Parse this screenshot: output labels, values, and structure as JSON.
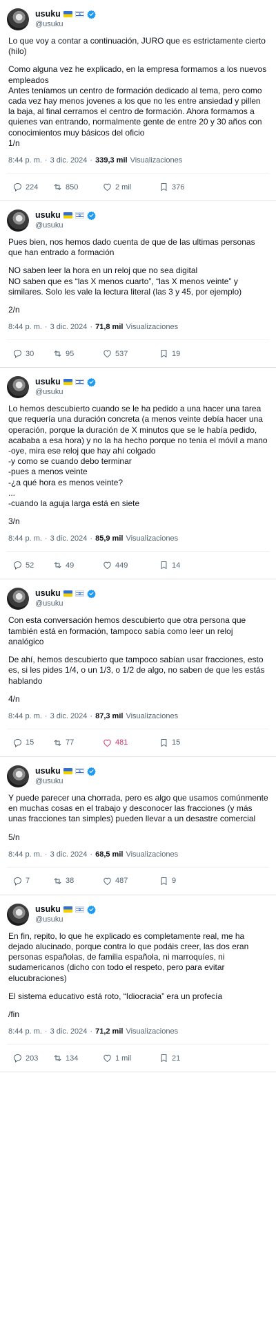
{
  "author": {
    "name": "usuku",
    "handle": "@usuku"
  },
  "labels": {
    "views_suffix": "Visualizaciones",
    "dot": "·"
  },
  "tweets": [
    {
      "paragraphs": [
        "Lo que voy a contar a continuación, JURO que es estrictamente cierto (hilo)",
        "Como alguna vez he explicado, en la empresa formamos a los nuevos empleados\nAntes teníamos un centro de formación dedicado al tema, pero como cada vez hay menos jovenes a los que no les entre ansiedad y pillen la baja, al final cerramos el centro de formación. Ahora formamos a quienes van entrando, normalmente gente de entre 20 y 30 años con conocimientos muy básicos del oficio\n1/n"
      ],
      "time": "8:44 p. m.",
      "date": "3 dic. 2024",
      "views": "339,3 mil",
      "replies": "224",
      "retweets": "850",
      "likes": "2 mil",
      "bookmarks": "376",
      "liked": false
    },
    {
      "paragraphs": [
        "Pues bien, nos hemos dado cuenta de que de las ultimas personas que han entrado a formación",
        "NO saben leer la hora en un reloj que no sea digital\nNO saben que es “las X menos cuarto”, “las X menos veinte” y similares. Solo les vale la lectura literal (las 3 y 45, por ejemplo)",
        "2/n"
      ],
      "time": "8:44 p. m.",
      "date": "3 dic. 2024",
      "views": "71,8 mil",
      "replies": "30",
      "retweets": "95",
      "likes": "537",
      "bookmarks": "19",
      "liked": false
    },
    {
      "paragraphs": [
        "Lo hemos descubierto cuando se le ha pedido a una hacer una tarea que requería una duración concreta (a menos veinte debía hacer una operación, porque la duración de X minutos que se le había pedido, acababa a esa hora) y no la ha hecho porque no tenia el móvil a mano\n-oye, mira ese reloj que hay ahí colgado\n-y como se cuando debo terminar\n-pues a menos veinte\n-¿a qué hora es menos veinte?\n...\n-cuando la aguja larga está en siete",
        "3/n"
      ],
      "time": "8:44 p. m.",
      "date": "3 dic. 2024",
      "views": "85,9 mil",
      "replies": "52",
      "retweets": "49",
      "likes": "449",
      "bookmarks": "14",
      "liked": false
    },
    {
      "paragraphs": [
        "Con esta conversación hemos descubierto que otra persona que también está en formación, tampoco sabía como leer un reloj analógico",
        "De ahí, hemos descubierto que tampoco sabían usar fracciones, esto es, si les pides 1/4, o un 1/3, o 1/2 de algo, no saben de que les estás hablando",
        "4/n"
      ],
      "time": "8:44 p. m.",
      "date": "3 dic. 2024",
      "views": "87,3 mil",
      "replies": "15",
      "retweets": "77",
      "likes": "481",
      "bookmarks": "15",
      "liked": true
    },
    {
      "paragraphs": [
        "Y puede parecer una chorrada, pero es algo que usamos comúnmente en muchas cosas en el trabajo y desconocer las fracciones (y más unas fracciones tan simples) pueden llevar a un desastre comercial",
        "5/n"
      ],
      "time": "8:44 p. m.",
      "date": "3 dic. 2024",
      "views": "68,5 mil",
      "replies": "7",
      "retweets": "38",
      "likes": "487",
      "bookmarks": "9",
      "liked": false
    },
    {
      "paragraphs": [
        "En fin, repito, lo que he explicado es completamente real, me ha dejado alucinado, porque contra lo que podáis creer, las dos eran personas españolas, de familia española, ni marroquíes, ni sudamericanos (dicho con todo el respeto, pero para evitar elucubraciones)",
        "El sistema educativo está roto, “Idiocracia” era un profecía",
        " /fin"
      ],
      "time": "8:44 p. m.",
      "date": "3 dic. 2024",
      "views": "71,2 mil",
      "replies": "203",
      "retweets": "134",
      "likes": "1 mil",
      "bookmarks": "21",
      "liked": false
    }
  ]
}
